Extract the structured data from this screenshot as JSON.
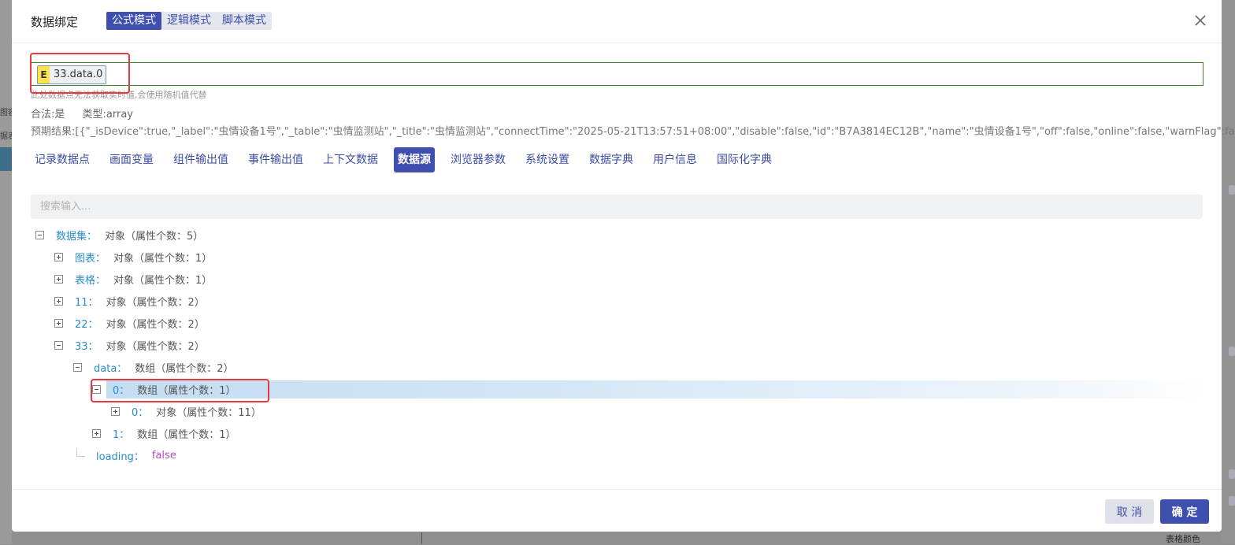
{
  "background": {
    "left_fragments": [
      "图容",
      "据表"
    ],
    "bottom_label": "表格颜色"
  },
  "dialog": {
    "title": "数据绑定",
    "modes": [
      {
        "label": "公式模式",
        "active": true
      },
      {
        "label": "逻辑模式",
        "active": false
      },
      {
        "label": "脚本模式",
        "active": false
      }
    ]
  },
  "formula": {
    "chip_badge": "E",
    "chip_text": "33.data.0",
    "hint": "此处数据点无法获取实时值,会使用随机值代替",
    "valid": "合法:是",
    "type": "类型:array",
    "expected": "预期结果:[{\"_isDevice\":true,\"_label\":\"虫情设备1号\",\"_table\":\"虫情监测站\",\"_title\":\"虫情监测站\",\"connectTime\":\"2025-05-21T13:57:51+08:00\",\"disable\":false,\"id\":\"B7A3814EC12B\",\"name\":\"虫情设备1号\",\"off\":false,\"online\":false,\"warnFlag\":false}]"
  },
  "tabs": [
    "记录数据点",
    "画面变量",
    "组件输出值",
    "事件输出值",
    "上下文数据",
    "数据源",
    "浏览器参数",
    "系统设置",
    "数据字典",
    "用户信息",
    "国际化字典"
  ],
  "active_tab": "数据源",
  "search": {
    "placeholder": "搜索输入..."
  },
  "tree": [
    {
      "key": "数据集：",
      "value": "对象（属性个数：5）",
      "expanded": true
    },
    {
      "key": "图表：",
      "value": "对象（属性个数：1）",
      "expanded": false
    },
    {
      "key": "表格：",
      "value": "对象（属性个数：1）",
      "expanded": false
    },
    {
      "key": "11：",
      "value": "对象（属性个数：2）",
      "expanded": false
    },
    {
      "key": "22：",
      "value": "对象（属性个数：2）",
      "expanded": false
    },
    {
      "key": "33：",
      "value": "对象（属性个数：2）",
      "expanded": true
    },
    {
      "key": "data：",
      "value": "数组（属性个数：2）",
      "expanded": true
    },
    {
      "key": "0：",
      "value": "数组（属性个数：1）",
      "expanded": true,
      "selected": true
    },
    {
      "key": "0：",
      "value": "对象（属性个数：11）",
      "expanded": false
    },
    {
      "key": "1：",
      "value": "数组（属性个数：1）",
      "expanded": false
    },
    {
      "key": "loading：",
      "value": "false",
      "leaf": true
    }
  ],
  "footer": {
    "cancel": "取 消",
    "ok": "确 定"
  },
  "colors": {
    "primary": "#3f4fb0",
    "key": "#2a8dc8",
    "highlight": "#e8383d",
    "valid_border": "#3b8a2a"
  }
}
